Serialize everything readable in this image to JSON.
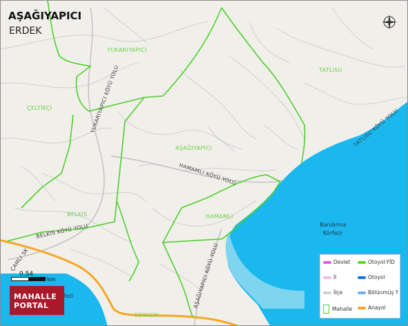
{
  "map": {
    "title": "AŞAĞIYAPICI",
    "subtitle": "ERDEK",
    "colors": {
      "land": "#f1efea",
      "water": "#1ab8ee",
      "shallow_water": "#7fd5f0",
      "boundary": "#4ccf2a",
      "local_road": "#c8c8c8",
      "main_road": "#f5a623"
    },
    "places": [
      "YUKARIYAPICI",
      "ÇELTİKÇİ",
      "TATLISU",
      "AŞAĞIYAPICI",
      "BELKIS",
      "HAMAMLI",
      "EDİNCİK"
    ],
    "roads": [
      "YUKARIYAPICI KÖYÜ YOLU",
      "HAMAMLI KÖYÜ YOLU",
      "TATLISU KÖYÜ YOLU",
      "BELKIS KÖYÜ YOLU",
      "ÇAMLI SK",
      "AŞAĞIYAPICI KÖYÜ YOLU"
    ],
    "water": [
      "Bandırma",
      "Körfezi",
      "fezi"
    ],
    "scale": {
      "value": "0.54",
      "unit": "km"
    },
    "logo": {
      "line1": "MAHALLE",
      "line2": "PORTAL"
    },
    "compass_icon": "compass-rose-icon"
  },
  "legend": {
    "items": [
      {
        "label": "Devlet",
        "color": "#e85be8"
      },
      {
        "label": "Otoyol-YİD",
        "color": "#55e01a"
      },
      {
        "label": "İl",
        "color": "#f3b8f0"
      },
      {
        "label": "Otoyol",
        "color": "#1c6fe0"
      },
      {
        "label": "İlçe",
        "color": "#d0d0d0"
      },
      {
        "label": "Bölünmüş Y",
        "color": "#6fb0ea"
      },
      {
        "label": "Mahalle",
        "color": "#4ccf2a"
      },
      {
        "label": "Anayol",
        "color": "#f5a623"
      }
    ]
  }
}
